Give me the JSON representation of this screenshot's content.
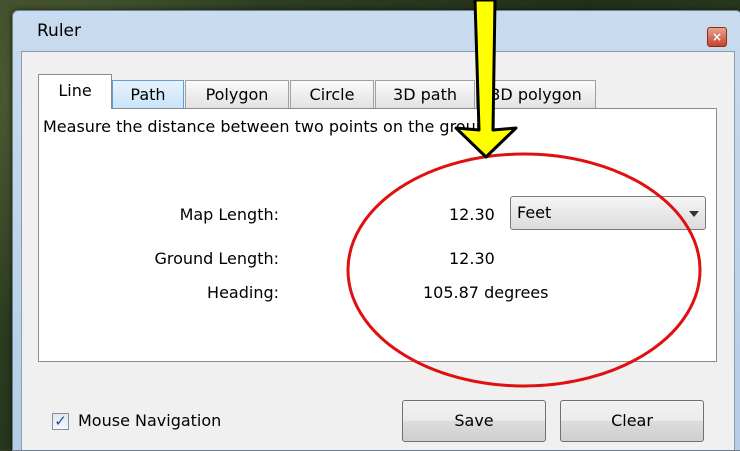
{
  "window": {
    "title": "Ruler",
    "close_glyph": "×"
  },
  "tabs": [
    {
      "label": "Line",
      "active": true
    },
    {
      "label": "Path"
    },
    {
      "label": "Polygon"
    },
    {
      "label": "Circle"
    },
    {
      "label": "3D path"
    },
    {
      "label": "3D polygon"
    }
  ],
  "panel": {
    "description": "Measure the distance between two points on the ground",
    "map_length_label": "Map Length:",
    "map_length_value": "12.30",
    "unit_selected": "Feet",
    "ground_length_label": "Ground Length:",
    "ground_length_value": "12.30",
    "heading_label": "Heading:",
    "heading_value": "105.87 degrees"
  },
  "footer": {
    "checkbox_checked_glyph": "✓",
    "mouse_navigation_label": "Mouse Navigation",
    "save_label": "Save",
    "clear_label": "Clear"
  },
  "annotations": {
    "arrow_color": "#ffff00",
    "circle_color": "#e01010"
  }
}
